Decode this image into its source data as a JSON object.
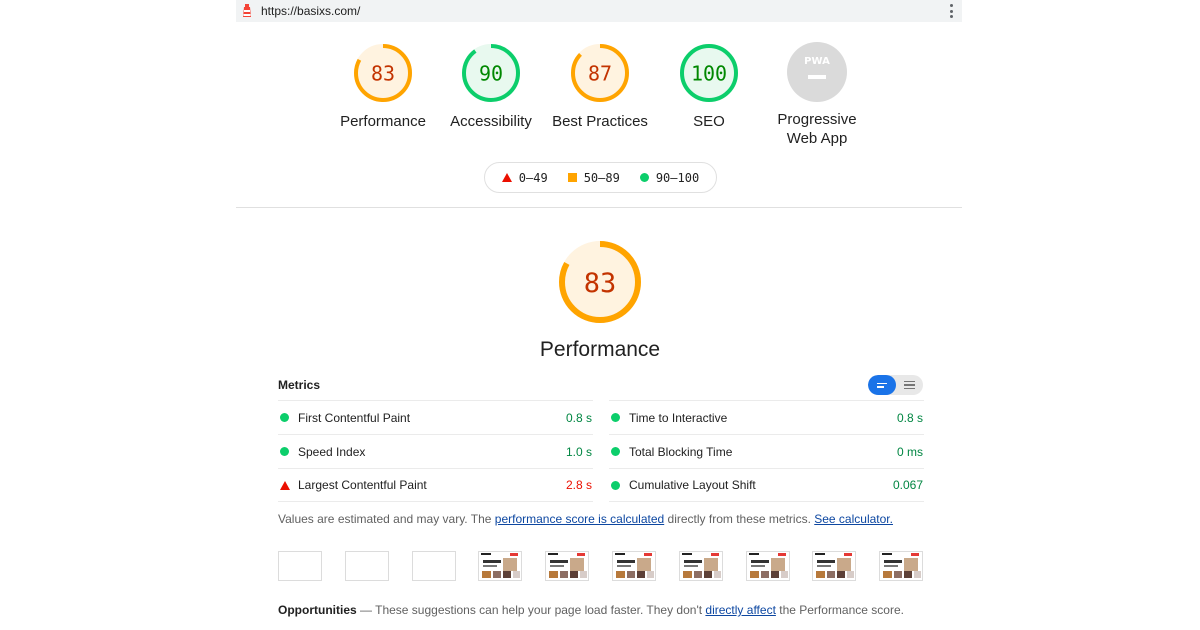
{
  "browser": {
    "url": "https://basixs.com/"
  },
  "colors": {
    "fail": "#eb0f00",
    "average": "#ffa400",
    "pass": "#0cce6b",
    "link": "#0d47a1",
    "toggle_active": "#1a73e8"
  },
  "gauges": [
    {
      "score": "83",
      "label": "Performance",
      "value": 0.83,
      "rating": "average"
    },
    {
      "score": "90",
      "label": "Accessibility",
      "value": 0.9,
      "rating": "pass"
    },
    {
      "score": "87",
      "label": "Best Practices",
      "value": 0.87,
      "rating": "average"
    },
    {
      "score": "100",
      "label": "SEO",
      "value": 1.0,
      "rating": "pass"
    }
  ],
  "pwa": {
    "badge": "PWA",
    "label_line1": "Progressive",
    "label_line2": "Web App"
  },
  "legend": {
    "fail": "0–49",
    "average": "50–89",
    "pass": "90–100"
  },
  "performance": {
    "score": "83",
    "value": 0.83,
    "title": "Performance"
  },
  "metrics": {
    "header": "Metrics",
    "left": [
      {
        "name": "First Contentful Paint",
        "value": "0.8 s",
        "rating": "pass"
      },
      {
        "name": "Speed Index",
        "value": "1.0 s",
        "rating": "pass"
      },
      {
        "name": "Largest Contentful Paint",
        "value": "2.8 s",
        "rating": "fail"
      }
    ],
    "right": [
      {
        "name": "Time to Interactive",
        "value": "0.8 s",
        "rating": "pass"
      },
      {
        "name": "Total Blocking Time",
        "value": "0 ms",
        "rating": "pass"
      },
      {
        "name": "Cumulative Layout Shift",
        "value": "0.067",
        "rating": "pass"
      }
    ]
  },
  "note": {
    "prefix": "Values are estimated and may vary. The ",
    "link1": "performance score is calculated",
    "middle": " directly from these metrics. ",
    "link2": "See calculator."
  },
  "filmstrip": {
    "blank_frames": 3,
    "loaded_frames": 7
  },
  "opportunities": {
    "title": "Opportunities",
    "prefix": " — These suggestions can help your page load faster. They don't ",
    "link": "directly affect",
    "suffix": " the Performance score."
  }
}
